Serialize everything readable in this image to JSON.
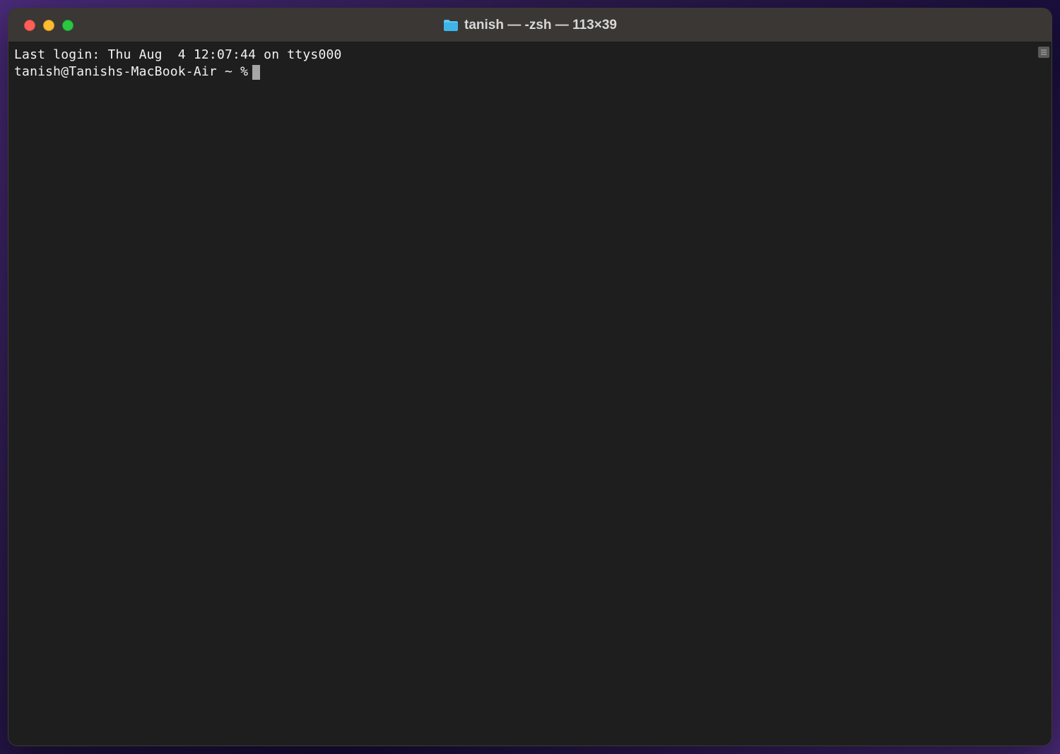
{
  "window": {
    "title": "tanish — -zsh — 113×39"
  },
  "terminal": {
    "last_login": "Last login: Thu Aug  4 12:07:44 on ttys000",
    "prompt": "tanish@Tanishs-MacBook-Air ~ %",
    "command": ""
  }
}
